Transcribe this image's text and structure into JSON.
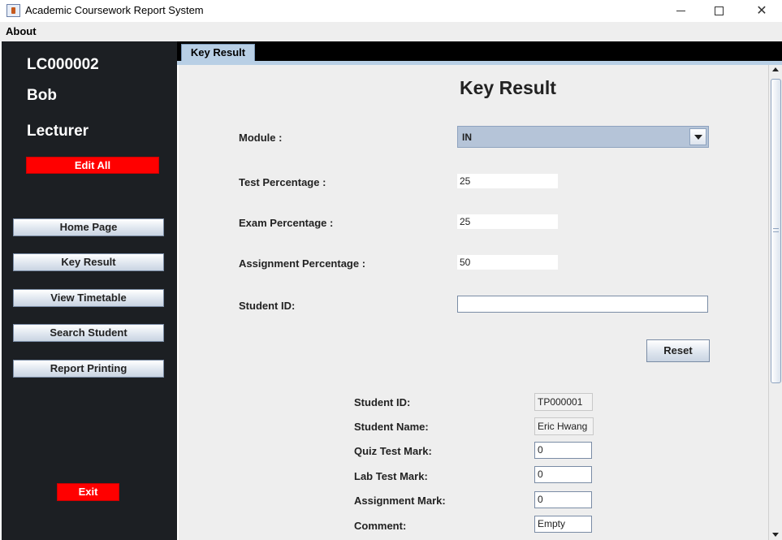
{
  "window": {
    "title": "Academic Coursework Report System",
    "controls": {
      "minimize": "minimize-icon",
      "maximize": "maximize-icon",
      "close": "✕"
    }
  },
  "menu": {
    "about": "About"
  },
  "sidebar": {
    "user_id": "LC000002",
    "user_name": "Bob",
    "user_role": "Lecturer",
    "edit_all": "Edit All",
    "nav": [
      "Home Page",
      "Key Result",
      "View Timetable",
      "Search Student",
      "Report Printing"
    ],
    "exit": "Exit"
  },
  "tabs": {
    "active": "Key Result"
  },
  "form": {
    "title": "Key Result",
    "module_label": "Module :",
    "module_value": "IN",
    "test_pct_label": "Test Percentage :",
    "test_pct_value": "25",
    "exam_pct_label": "Exam Percentage :",
    "exam_pct_value": "25",
    "assign_pct_label": "Assignment Percentage :",
    "assign_pct_value": "50",
    "student_id_label": "Student ID:",
    "student_id_value": "",
    "reset": "Reset"
  },
  "details": {
    "student_id_label": "Student ID:",
    "student_id_value": "TP000001",
    "student_name_label": "Student Name:",
    "student_name_value": "Eric Hwang",
    "quiz_label": "Quiz Test Mark:",
    "quiz_value": "0",
    "lab_label": "Lab Test Mark:",
    "lab_value": "0",
    "assignment_label": "Assignment Mark:",
    "assignment_value": "0",
    "comment_label": "Comment:",
    "comment_value": "Empty"
  },
  "colors": {
    "sidebar_bg": "#1c1f23",
    "danger": "#ff0000",
    "tab_active": "#b8cfe5",
    "content_bg": "#eeeeee"
  }
}
